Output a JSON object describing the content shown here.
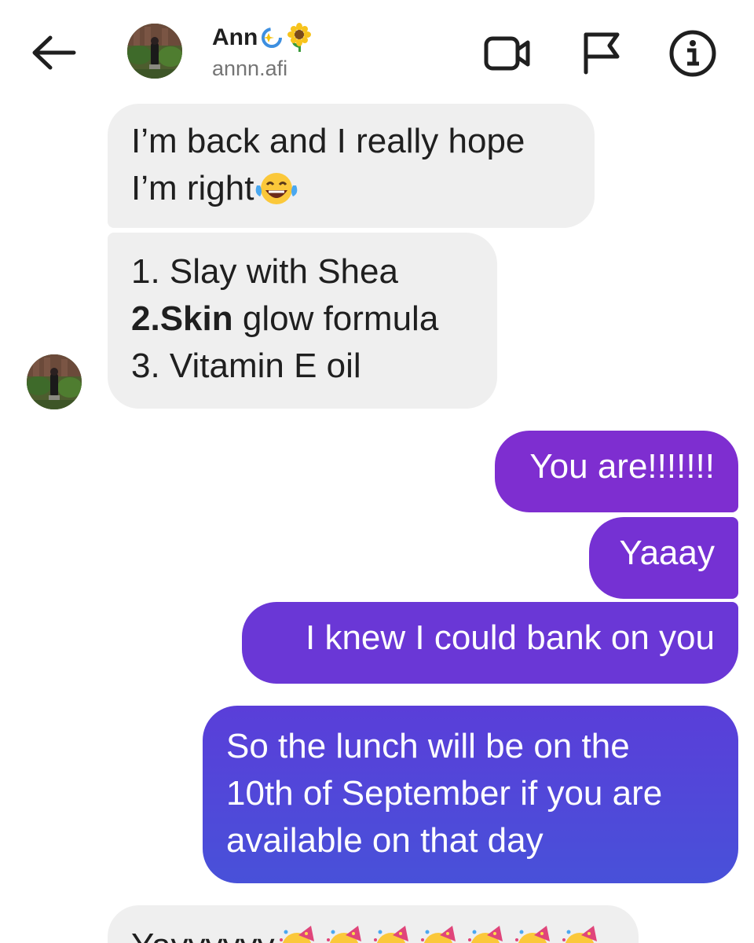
{
  "header": {
    "contact_name": "Ann",
    "name_emojis": [
      "sparkle-loop-emoji",
      "sunflower-emoji"
    ],
    "handle": "annn.afi",
    "icons": [
      "back-arrow-icon",
      "video-call-icon",
      "flag-icon",
      "info-icon"
    ]
  },
  "messages": {
    "incoming_1": {
      "line1": "I’m back and I really hope",
      "line2": "I’m right",
      "emoji": "laughing-tears-emoji"
    },
    "incoming_2": {
      "item1": "1. Slay with Shea",
      "item2_bold": "2.Skin",
      "item2_rest": " glow formula",
      "item3": "3. Vitamin E oil"
    },
    "outgoing_1": "You are!!!!!!!",
    "outgoing_2": "Yaaay",
    "outgoing_3": "I knew I could bank on you",
    "outgoing_4": {
      "line1": "So the lunch will be on the",
      "line2": "10th of September if you are",
      "line3": "available on that day"
    },
    "incoming_3": {
      "text": "Yayyyyyy",
      "emoji": "party-face-emoji",
      "emoji_count": 7
    }
  },
  "colors": {
    "incoming_bubble": "#efefef",
    "outgoing_top": "#7e2ed0",
    "outgoing_bottom": "#4851d9",
    "text_dark": "#1f1f1f",
    "handle_gray": "#757575"
  }
}
